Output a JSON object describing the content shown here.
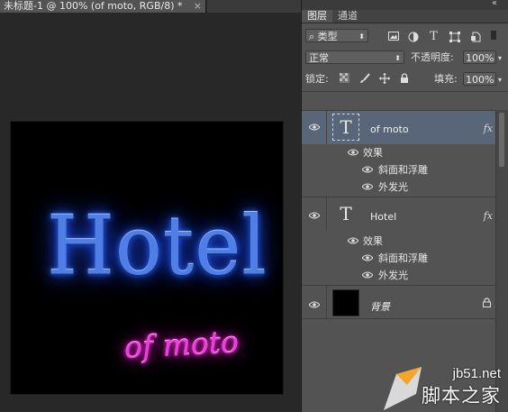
{
  "document": {
    "tab_title": "未标题-1 @ 100% (of moto, RGB/8) *",
    "close_glyph": "×",
    "canvas": {
      "main_text": "Hotel",
      "sub_text": "of moto",
      "main_color": "#4f7fe6",
      "sub_color": "#e641d8"
    }
  },
  "panel": {
    "collapse_glyph": "«",
    "tabs": [
      "图层",
      "通道"
    ],
    "filter": {
      "kind_label": "类型",
      "search_glyph": "⌕"
    },
    "filter_icons": [
      "image-filter-icon",
      "adjustment-filter-icon",
      "type-filter-icon",
      "shape-filter-icon",
      "smart-object-filter-icon"
    ],
    "blend_mode": "正常",
    "opacity_label": "不透明度:",
    "opacity_value": "100%",
    "lock_label": "锁定:",
    "fill_label": "填充:",
    "fill_value": "100%",
    "layers": [
      {
        "name": "of moto",
        "type_glyph": "T",
        "fx": "fx",
        "selected": true,
        "effects_label": "效果",
        "effects": [
          "斜面和浮雕",
          "外发光"
        ]
      },
      {
        "name": "Hotel",
        "type_glyph": "T",
        "fx": "fx",
        "selected": false,
        "effects_label": "效果",
        "effects": [
          "斜面和浮雕",
          "外发光"
        ]
      },
      {
        "name": "背景",
        "locked": true
      }
    ]
  },
  "watermark": {
    "url": "jb51.net",
    "site": "脚本之家"
  }
}
